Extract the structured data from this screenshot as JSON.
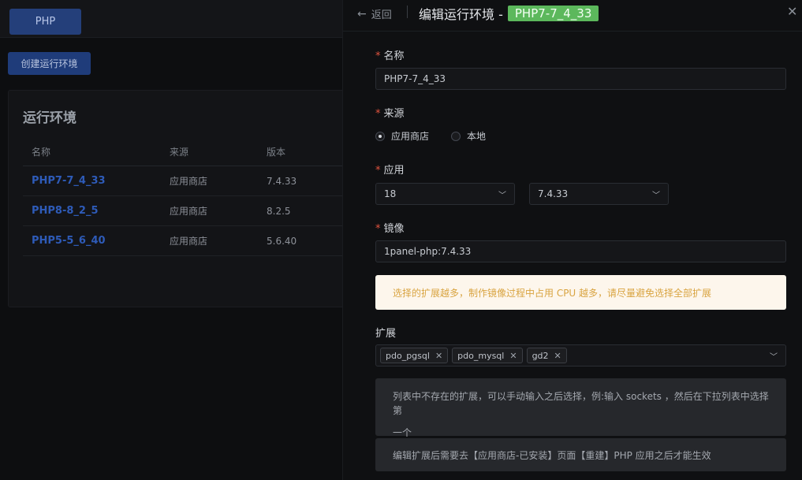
{
  "background": {
    "tab_label": "PHP",
    "create_button": "创建运行环境",
    "card_title": "运行环境",
    "columns": [
      "名称",
      "来源",
      "版本"
    ],
    "rows": [
      {
        "name": "PHP7-7_4_33",
        "source": "应用商店",
        "version": "7.4.33"
      },
      {
        "name": "PHP8-8_2_5",
        "source": "应用商店",
        "version": "8.2.5"
      },
      {
        "name": "PHP5-5_6_40",
        "source": "应用商店",
        "version": "5.6.40"
      }
    ]
  },
  "drawer": {
    "back_label": "返回",
    "title": "编辑运行环境 -",
    "title_badge": "PHP7-7_4_33",
    "name_label": "名称",
    "name_value": "PHP7-7_4_33",
    "source_label": "来源",
    "source_options": [
      "应用商店",
      "本地"
    ],
    "app_label": "应用",
    "app_value": "18",
    "version_value": "7.4.33",
    "image_label": "镜像",
    "image_value": "1panel-php:7.4.33",
    "warning": "选择的扩展越多，制作镜像过程中占用 CPU 越多，请尽量避免选择全部扩展",
    "ext_label": "扩展",
    "extensions": [
      "pdo_pgsql",
      "pdo_mysql",
      "gd2"
    ],
    "info1_line1": "列表中不存在的扩展，可以手动输入之后选择，例:输入 sockets ，然后在下拉列表中选择第",
    "info1_line2": "一个",
    "info2": "编辑扩展后需要去【应用商店-已安装】页面【重建】PHP 应用之后才能生效"
  },
  "colors": {
    "accent": "#2e5bb8",
    "badge": "#5cb85c",
    "required": "#e2533f",
    "warning_text": "#d9a441"
  }
}
